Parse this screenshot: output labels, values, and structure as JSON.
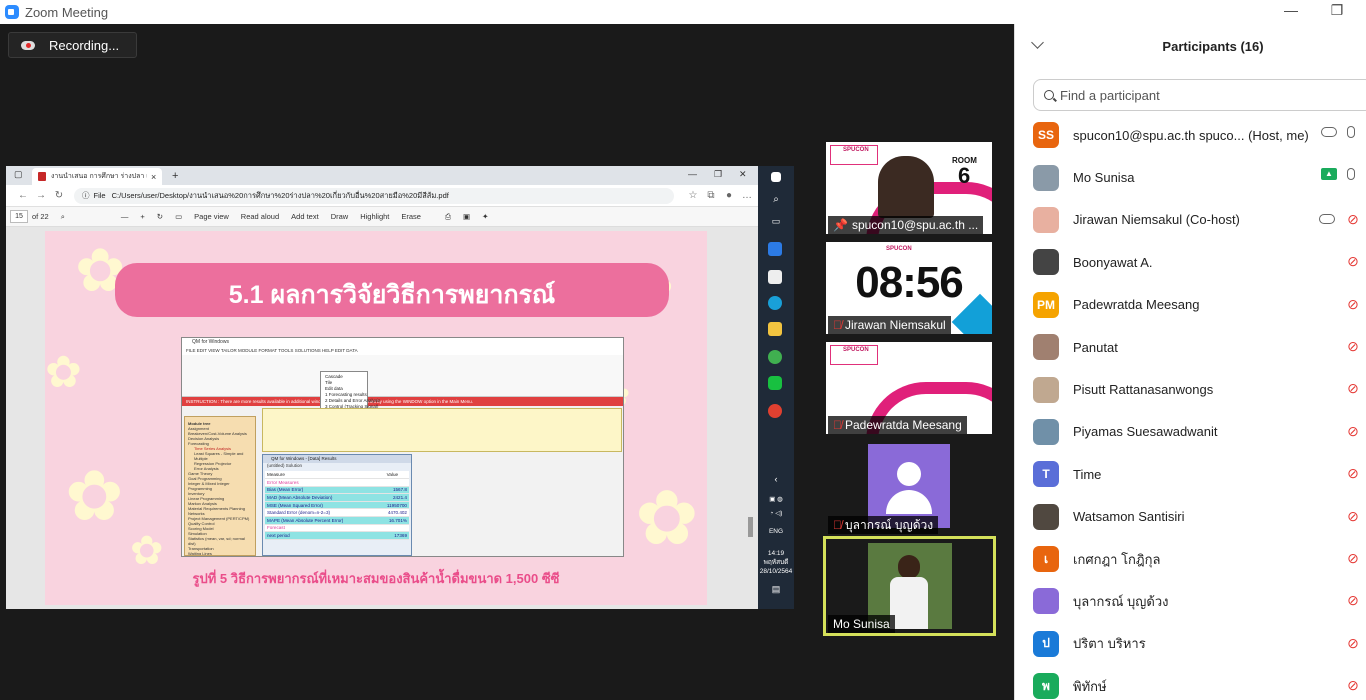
{
  "window": {
    "title": "Zoom Meeting",
    "minimize": "—",
    "restore": "❐"
  },
  "recording": {
    "label": "Recording..."
  },
  "browser": {
    "tab_title": "งานนำเสนอ การศึกษา ร่างปลา เพื่อง",
    "tab_close": "×",
    "new_tab": "+",
    "url_prefix": "File",
    "url": "C:/Users/user/Desktop/งานนำเสนอ%20การศึกษา%20ร่างปลา%20เกี่ยวกับอื่น%20สายมือ%20มีสีส้ม.pdf",
    "pdf_toolbar": {
      "page": "15",
      "of_pages": "of 22",
      "page_view": "Page view",
      "read_aloud": "Read aloud",
      "add_text": "Add text",
      "draw": "Draw",
      "highlight": "Highlight",
      "erase": "Erase"
    }
  },
  "slide": {
    "title": "5.1 ผลการวิจัยวิธีการพยากรณ์",
    "caption": "รูปที่ 5 วิธีการพยากรณ์ที่เหมาะสมของสินค้าน้ำดื่มขนาด 1,500 ซีซี",
    "qm": {
      "window_title": "QM for Windows",
      "menu": "FILE   EDIT   VIEW   TAILOR   MODULE   FORMAT   TOOLS   SOLUTIONS   HELP   EDIT DATA",
      "strip": "INSTRUCTION : There are more results available in additional windows. These may be opened by using the WINDOW option in the Main Menu.",
      "dropdown": [
        "Cascade",
        "Tile",
        "Edit data",
        "1 Forecasting results",
        "2 Details and Error Analysis",
        "3 Control (Tracking Signal)",
        "4 Graph"
      ],
      "tree_title": "Module tree",
      "tree": [
        "Assignment",
        "Breakeven/Cost-Volume Analysis",
        "Decision Analysis",
        "Forecasting",
        "Time Series Analysis",
        "Least Squares - Simple and Multiple",
        "Regression Projector",
        "Error Analysis",
        "Game Theory",
        "Goal Programming",
        "Integer & Mixed Integer Programming",
        "Inventory",
        "Linear Programming",
        "Markov Analysis",
        "Material Requirements Planning",
        "Networks",
        "Project Management (PERT/CPM)",
        "Quality Control",
        "Scoring Model",
        "Simulation",
        "Statistics (mean, var, sd; normal dist)",
        "Transportation",
        "Waiting Lines"
      ],
      "results_title": "QM for Windows - [Data] Results",
      "results_subtitle": "(untitled) Solution",
      "results_header": [
        "Measure",
        "Value"
      ],
      "results_rows": [
        [
          "Error Measures",
          ""
        ],
        [
          "Bias (Mean Error)",
          "1567.8"
        ],
        [
          "MAD (Mean Absolute Deviation)",
          "2421.4"
        ],
        [
          "MSE (Mean Squared Error)",
          "11950700"
        ],
        [
          "Standard Error (denom=n-2=3)",
          "4470.402"
        ],
        [
          "MAPE (Mean Absolute Percent Error)",
          "16.701%"
        ],
        [
          "Forecast",
          ""
        ],
        [
          "next period",
          "17369"
        ]
      ]
    }
  },
  "taskbar": {
    "lang": "ENG",
    "time": "14:19",
    "day": "พฤหัสบดี",
    "date": "28/10/2564"
  },
  "videos": [
    {
      "name": "spucon10@spu.ac.th ...",
      "room_label": "ROOM",
      "room_number": "6"
    },
    {
      "name": "Jirawan Niemsakul",
      "clock": "08:56"
    },
    {
      "name": "Padewratda Meesang"
    },
    {
      "name": "บุลากรณ์ บุญด้วง"
    },
    {
      "name": "Mo Sunisa"
    }
  ],
  "participants": {
    "title": "Participants (16)",
    "search_placeholder": "Find a participant",
    "list": [
      {
        "name": "spucon10@spu.ac.th spuco...  (Host, me)",
        "initials": "SS",
        "color": "#e8650e",
        "status": "host"
      },
      {
        "name": "Mo Sunisa",
        "initials": "",
        "color": "#8a9aa8",
        "status": "sharing"
      },
      {
        "name": "Jirawan Niemsakul (Co-host)",
        "initials": "",
        "color": "#e8b0a0",
        "status": "cohost"
      },
      {
        "name": "Boonyawat A.",
        "initials": "",
        "color": "#444444",
        "status": "muted"
      },
      {
        "name": "Padewratda Meesang",
        "initials": "PM",
        "color": "#f5a300",
        "status": "muted"
      },
      {
        "name": "Panutat",
        "initials": "",
        "color": "#a08070",
        "status": "muted"
      },
      {
        "name": "Pisutt Rattanasanwongs",
        "initials": "",
        "color": "#c0a890",
        "status": "muted"
      },
      {
        "name": "Piyamas Suesawadwanit",
        "initials": "",
        "color": "#7090a8",
        "status": "muted"
      },
      {
        "name": "Time",
        "initials": "T",
        "color": "#5a6ed8",
        "status": "muted"
      },
      {
        "name": "Watsamon Santisiri",
        "initials": "",
        "color": "#504840",
        "status": "muted"
      },
      {
        "name": "เกศกฎา โกฎิกุล",
        "initials": "เ",
        "color": "#e8650e",
        "status": "muted"
      },
      {
        "name": "บุลากรณ์ บุญด้วง",
        "initials": "",
        "color": "#8a6ad8",
        "status": "muted"
      },
      {
        "name": "ปริตา บริหาร",
        "initials": "ป",
        "color": "#1a7ad8",
        "status": "muted"
      },
      {
        "name": "พิทักษ์",
        "initials": "พ",
        "color": "#1aab5c",
        "status": "muted"
      }
    ]
  }
}
